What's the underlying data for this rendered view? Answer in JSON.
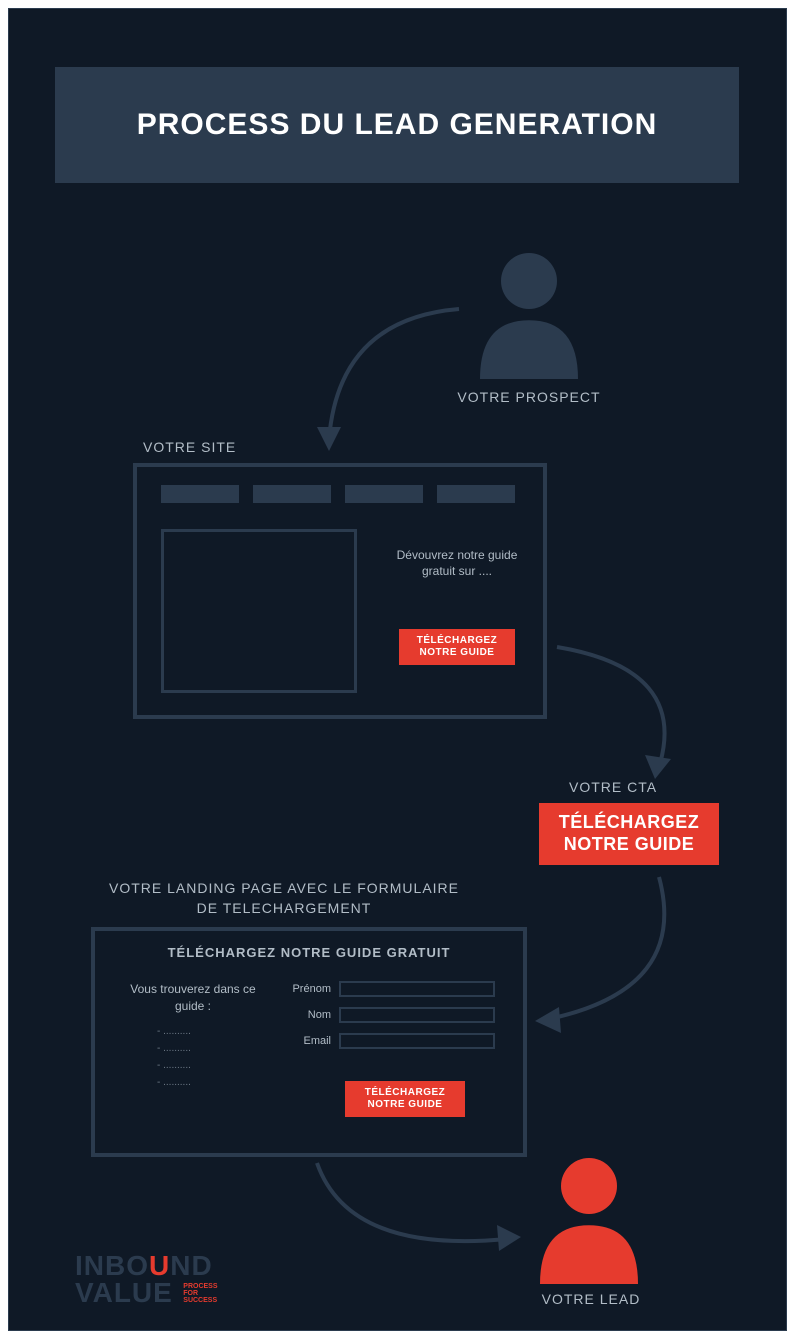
{
  "title": "PROCESS DU LEAD GENERATION",
  "prospect_label": "VOTRE PROSPECT",
  "site": {
    "label": "VOTRE SITE",
    "teaser": "Dévouvrez notre guide gratuit sur ....",
    "cta": "TÉLÉCHARGEZ NOTRE GUIDE"
  },
  "cta": {
    "label": "VOTRE CTA",
    "button": "TÉLÉCHARGEZ NOTRE GUIDE"
  },
  "landing_page": {
    "label": "VOTRE LANDING PAGE AVEC LE FORMULAIRE DE TELECHARGEMENT",
    "title": "TÉLÉCHARGEZ NOTRE GUIDE GRATUIT",
    "intro": "Vous trouverez dans ce guide :",
    "bullets": [
      "- ..........",
      "- ..........",
      "- ..........",
      "- .........."
    ],
    "fields": {
      "prenom": "Prénom",
      "nom": "Nom",
      "email": "Email"
    },
    "button": "TÉLÉCHARGEZ NOTRE GUIDE"
  },
  "lead_label": "VOTRE LEAD",
  "logo": {
    "line1a": "INBO",
    "line1u": "U",
    "line1b": "ND",
    "line2": "VALUE",
    "tagline1": "PROCESS",
    "tagline2": "FOR",
    "tagline3": "SUCCESS"
  },
  "colors": {
    "bg": "#0f1926",
    "panel": "#2b3b4e",
    "accent": "#e63b2e",
    "muted": "#b2bdc7"
  }
}
